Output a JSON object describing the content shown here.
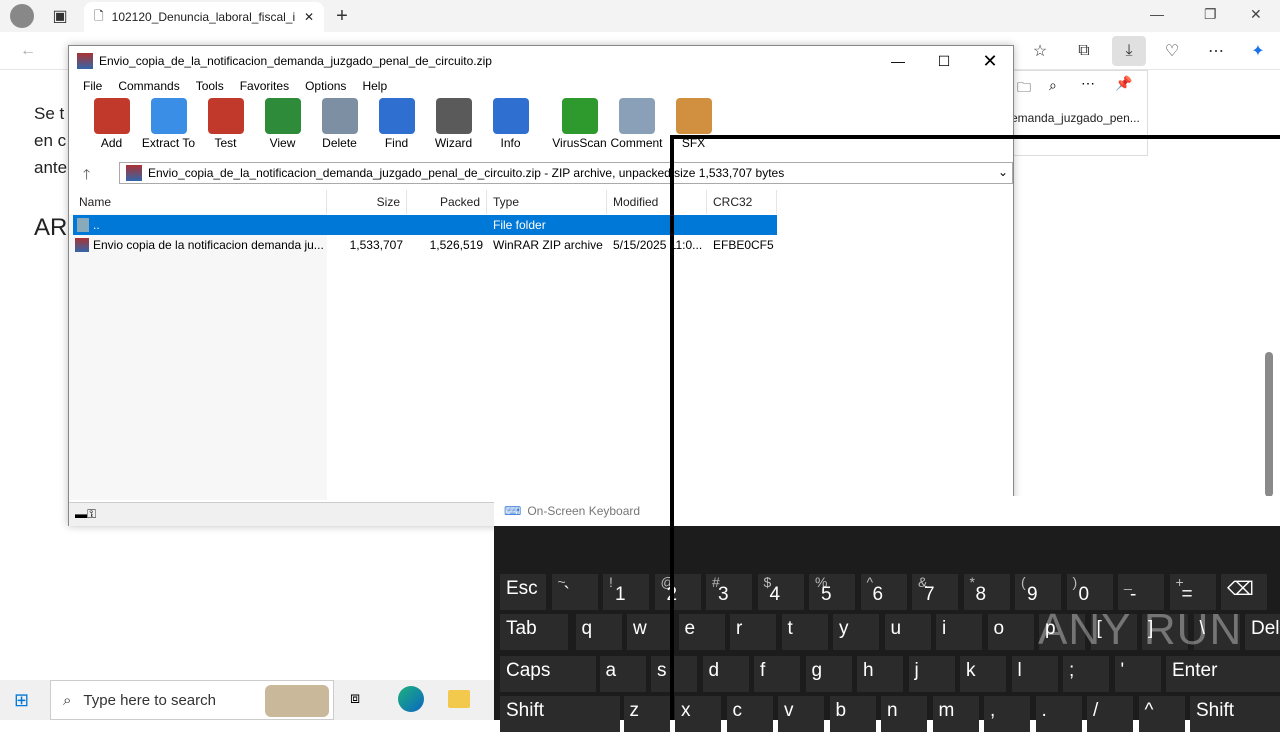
{
  "browser": {
    "tab_title": "102120_Denuncia_laboral_fiscal_i",
    "download_item": "emanda_juzgado_pen..."
  },
  "page": {
    "lines": [
      "Se t",
      "en c",
      "ante"
    ],
    "heading": "AR"
  },
  "winrar": {
    "title": "Envio_copia_de_la_notificacion_demanda_juzgado_penal_de_circuito.zip",
    "menu": [
      "File",
      "Commands",
      "Tools",
      "Favorites",
      "Options",
      "Help"
    ],
    "toolbar": [
      {
        "label": "Add",
        "icon": "add-archive-icon",
        "color": "#c0392b"
      },
      {
        "label": "Extract To",
        "icon": "extract-folder-icon",
        "color": "#3a8ee6"
      },
      {
        "label": "Test",
        "icon": "test-clipboard-icon",
        "color": "#c0392b"
      },
      {
        "label": "View",
        "icon": "view-book-icon",
        "color": "#2e8b3a"
      },
      {
        "label": "Delete",
        "icon": "trash-icon",
        "color": "#7d8fa3"
      },
      {
        "label": "Find",
        "icon": "magnifier-icon",
        "color": "#2f6fcf"
      },
      {
        "label": "Wizard",
        "icon": "magic-wand-icon",
        "color": "#5a5a5a"
      },
      {
        "label": "Info",
        "icon": "info-icon",
        "color": "#2f6fcf"
      },
      {
        "label": "VirusScan",
        "icon": "virus-scan-icon",
        "color": "#2e9a2e"
      },
      {
        "label": "Comment",
        "icon": "comment-icon",
        "color": "#8aa0b8"
      },
      {
        "label": "SFX",
        "icon": "sfx-box-icon",
        "color": "#d09040"
      }
    ],
    "path": "Envio_copia_de_la_notificacion_demanda_juzgado_penal_de_circuito.zip - ZIP archive, unpacked size 1,533,707 bytes",
    "columns": [
      "Name",
      "Size",
      "Packed",
      "Type",
      "Modified",
      "CRC32"
    ],
    "rows": [
      {
        "name": "..",
        "size": "",
        "packed": "",
        "type": "File folder",
        "modified": "",
        "crc": ""
      },
      {
        "name": "Envio copia de la notificacion demanda ju...",
        "size": "1,533,707",
        "packed": "1,526,519",
        "type": "WinRAR ZIP archive",
        "modified": "5/15/2025 11:0...",
        "crc": "EFBE0CF5"
      }
    ]
  },
  "osk": {
    "title": "On-Screen Keyboard",
    "row1": [
      {
        "m": "Esc",
        "s": ""
      },
      {
        "m": "`",
        "s": "~"
      },
      {
        "m": "1",
        "s": "!"
      },
      {
        "m": "2",
        "s": "@"
      },
      {
        "m": "3",
        "s": "#"
      },
      {
        "m": "4",
        "s": "$"
      },
      {
        "m": "5",
        "s": "%"
      },
      {
        "m": "6",
        "s": "^"
      },
      {
        "m": "7",
        "s": "&"
      },
      {
        "m": "8",
        "s": "*"
      },
      {
        "m": "9",
        "s": "("
      },
      {
        "m": "0",
        "s": ")"
      },
      {
        "m": "-",
        "s": "_"
      },
      {
        "m": "=",
        "s": "+"
      },
      {
        "m": "⌫",
        "s": ""
      }
    ],
    "row2": [
      "Tab",
      "q",
      "w",
      "e",
      "r",
      "t",
      "y",
      "u",
      "i",
      "o",
      "p",
      "[",
      "]",
      "\\",
      "Del"
    ],
    "row3": [
      "Caps",
      "a",
      "s",
      "d",
      "f",
      "g",
      "h",
      "j",
      "k",
      "l",
      ";",
      "'",
      "Enter"
    ],
    "row4": [
      "Shift",
      "z",
      "x",
      "c",
      "v",
      "b",
      "n",
      "m",
      ",",
      ".",
      "/",
      "^",
      "Shift"
    ]
  },
  "taskbar": {
    "search_placeholder": "Type here to search"
  },
  "watermark": "ANY RUN"
}
